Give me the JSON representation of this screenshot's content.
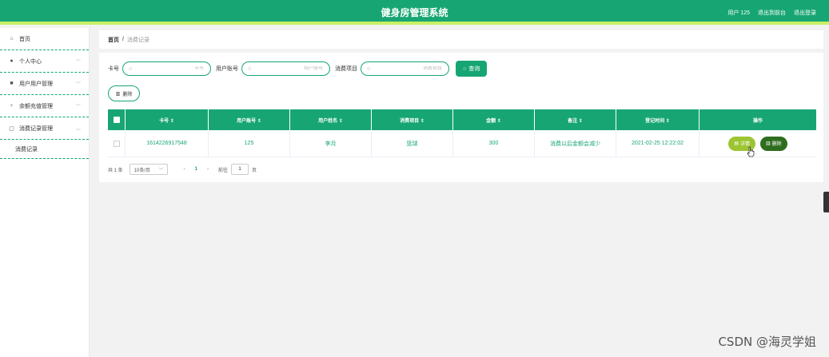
{
  "header": {
    "title": "健身房管理系统",
    "user": "用户 125",
    "exit_front": "退出到前台",
    "logout": "退出登录"
  },
  "sidebar": {
    "items": [
      {
        "label": "首页",
        "icon": "home-icon"
      },
      {
        "label": "个人中心",
        "icon": "user-icon"
      },
      {
        "label": "用户用户管理",
        "icon": "users-icon"
      },
      {
        "label": "余额充值管理",
        "icon": "mic-icon"
      },
      {
        "label": "消费记录管理",
        "icon": "box-icon"
      }
    ],
    "sub_item": "消费记录"
  },
  "breadcrumb": {
    "home": "首页",
    "separator": "/",
    "current": "消费记录"
  },
  "search": {
    "card_label": "卡号",
    "card_placeholder": "卡号",
    "account_label": "用户账号",
    "account_placeholder": "用户账号",
    "item_label": "消费项目",
    "item_placeholder": "消费项目",
    "button": "查询"
  },
  "toolbar": {
    "delete": "删除"
  },
  "table": {
    "headers": [
      "卡号 ⇕",
      "用户账号 ⇕",
      "用户姓名 ⇕",
      "消费项目 ⇕",
      "金额 ⇕",
      "备注 ⇕",
      "登记时间 ⇕",
      "操作"
    ],
    "rows": [
      {
        "card": "1614226917548",
        "account": "125",
        "name": "李月",
        "item": "篮球",
        "amount": "300",
        "note": "消费以后金额会减少",
        "time": "2021-02-25 12:22:02",
        "detail": "详情",
        "delete": "删除"
      }
    ]
  },
  "pager": {
    "total": "共 1 条",
    "size": "10条/页",
    "prev": "‹",
    "current": "1",
    "next": "›",
    "goto": "前往",
    "page_input": "1",
    "page_suffix": "页"
  },
  "watermark": "CSDN @海灵学姐",
  "colors": {
    "primary": "#17a673",
    "accent": "#c8f066",
    "detail": "#9dc533",
    "delete": "#2f6d1e"
  }
}
